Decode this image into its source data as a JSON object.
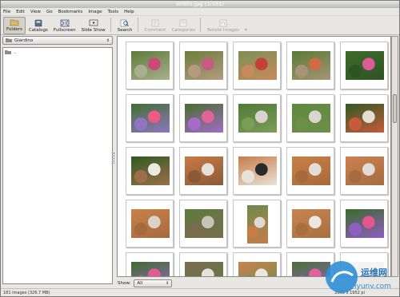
{
  "window": {
    "title": "00001.jpg (1/181)"
  },
  "menu": [
    "File",
    "Edit",
    "View",
    "Go",
    "Bookmarks",
    "Image",
    "Tools",
    "Help"
  ],
  "toolbar": {
    "folders": "Folders",
    "catalogs": "Catalogs",
    "fullscreen": "Fullscreen",
    "slideshow": "Slide Show",
    "search": "Search",
    "comment": "Comment",
    "categories": "Categories",
    "rotate": "Rotate Images"
  },
  "sidebar": {
    "location": "Giardino",
    "tree_item": ".."
  },
  "filter": {
    "label": "Show:",
    "value": "All"
  },
  "status": {
    "count": "181 images (326.7 MB)",
    "dimensions": "2608 x 1952 pi"
  },
  "watermark": {
    "text": "运维网",
    "url": "iyunv.com"
  },
  "thumbnails": [
    {
      "name": "flowers-pots",
      "a": "#5f7b3a",
      "b": "#c94a7a",
      "c": "#a7b08c",
      "tall": false
    },
    {
      "name": "flowers-pots-2",
      "a": "#6a7f3c",
      "b": "#c75b86",
      "c": "#b59a80",
      "tall": false
    },
    {
      "name": "pot-red-flowers",
      "a": "#7b8f55",
      "b": "#c2403a",
      "c": "#c88a5c",
      "tall": false
    },
    {
      "name": "pot-plant",
      "a": "#5b7a34",
      "b": "#d06a45",
      "c": "#a59477",
      "tall": false
    },
    {
      "name": "pink-rose",
      "a": "#3e6b2c",
      "b": "#e05a9a",
      "c": "#2f5423",
      "tall": false
    },
    {
      "name": "pink-rose-2",
      "a": "#3f7030",
      "b": "#ee5a86",
      "c": "#9076c0",
      "tall": false
    },
    {
      "name": "rose-bush",
      "a": "#466f2e",
      "b": "#e06495",
      "c": "#a56bc8",
      "tall": false
    },
    {
      "name": "cat-in-garden",
      "a": "#4f7a36",
      "b": "#d8d4cc",
      "c": "#7c9d58",
      "tall": false
    },
    {
      "name": "cats-lawn",
      "a": "#5d8a3e",
      "b": "#d9d6cf",
      "c": "#6d8f4a",
      "tall": false
    },
    {
      "name": "cat-wall",
      "a": "#2f5a22",
      "b": "#e2ddd5",
      "c": "#c65a3a",
      "tall": false
    },
    {
      "name": "cat-hedge",
      "a": "#2e5a22",
      "b": "#ece9e3",
      "c": "#9b6f4a",
      "tall": false
    },
    {
      "name": "cats-floor",
      "a": "#c97a45",
      "b": "#e6e1d8",
      "c": "#8a5a38",
      "tall": false
    },
    {
      "name": "cats-floor-2",
      "a": "#c77c48",
      "b": "#2a2a2a",
      "c": "#e8e3da",
      "tall": false
    },
    {
      "name": "cat-tiles",
      "a": "#c88047",
      "b": "#e4dfd6",
      "c": "#a86a3c",
      "tall": false
    },
    {
      "name": "cat-tiles-2",
      "a": "#cc8250",
      "b": "#e2ddd4",
      "c": "#a46c40",
      "tall": false
    },
    {
      "name": "cat-sitting",
      "a": "#c98149",
      "b": "#d9d3c9",
      "c": "#a66a3f",
      "tall": false
    },
    {
      "name": "garden-shrub",
      "a": "#5a7d3c",
      "b": "#c9c3b6",
      "c": "#7a6a4e",
      "tall": false
    },
    {
      "name": "cat-portrait",
      "a": "#6b8b4c",
      "b": "#dedad2",
      "c": "#c97c48",
      "tall": true
    },
    {
      "name": "cat-close",
      "a": "#c98452",
      "b": "#ece8e1",
      "c": "#a8703f",
      "tall": false
    },
    {
      "name": "rose-purple",
      "a": "#3a6a2a",
      "b": "#e2558f",
      "c": "#8f5fbf",
      "tall": false
    },
    {
      "name": "rose-row5",
      "a": "#3e6a2d",
      "b": "#e35a90",
      "c": "#9a6cc2",
      "tall": false
    },
    {
      "name": "cat-row5",
      "a": "#7c6a52",
      "b": "#e7e2d9",
      "c": "#5d7d3d",
      "tall": false
    },
    {
      "name": "cat-row5-2",
      "a": "#c98350",
      "b": "#ebe6de",
      "c": "#6c8c4a",
      "tall": false
    },
    {
      "name": "rose-row5-2",
      "a": "#4a6f35",
      "b": "#e4609a",
      "c": "#8d64c0",
      "tall": false
    },
    {
      "name": "blank-row5",
      "a": "#f4f4f4",
      "b": "#f4f4f4",
      "c": "#f4f4f4",
      "tall": false
    }
  ]
}
